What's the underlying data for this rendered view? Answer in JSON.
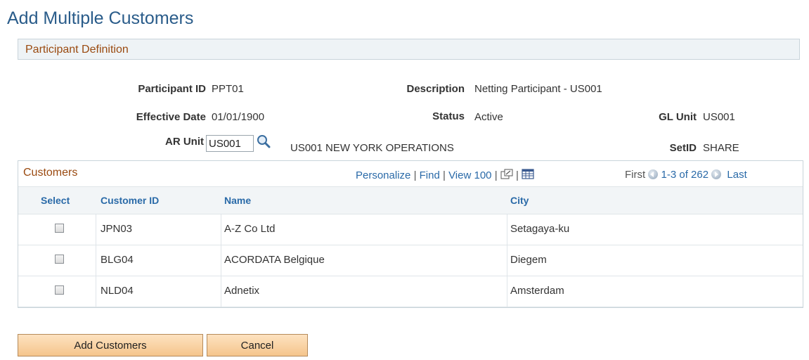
{
  "page": {
    "title": "Add Multiple Customers"
  },
  "section": {
    "title": "Participant Definition"
  },
  "fields": {
    "participant_id_label": "Participant ID",
    "participant_id_value": "PPT01",
    "description_label": "Description",
    "description_value": "Netting Participant - US001",
    "effective_date_label": "Effective Date",
    "effective_date_value": "01/01/1900",
    "status_label": "Status",
    "status_value": "Active",
    "gl_unit_label": "GL Unit",
    "gl_unit_value": "US001",
    "ar_unit_label": "AR Unit",
    "ar_unit_value": "US001",
    "ar_unit_description": "US001 NEW YORK OPERATIONS",
    "setid_label": "SetID",
    "setid_value": "SHARE"
  },
  "grid": {
    "title": "Customers",
    "personalize": "Personalize",
    "find": "Find",
    "view": "View 100",
    "first": "First",
    "range": "1-3 of 262",
    "last": "Last",
    "columns": [
      "Select",
      "Customer ID",
      "Name",
      "City"
    ],
    "rows": [
      {
        "customer_id": "JPN03",
        "name": "A-Z Co Ltd",
        "city": "Setagaya-ku"
      },
      {
        "customer_id": "BLG04",
        "name": "ACORDATA Belgique",
        "city": "Diegem"
      },
      {
        "customer_id": "NLD04",
        "name": "Adnetix",
        "city": "Amsterdam"
      }
    ]
  },
  "buttons": {
    "add": "Add Customers",
    "cancel": "Cancel"
  },
  "icons": {
    "lookup": "magnifier-icon",
    "new_window": "new-window-icon",
    "grid_view": "grid-icon",
    "prev": "prev-circle-icon",
    "next": "next-circle-icon"
  },
  "colors": {
    "title": "#2a5c8a",
    "section_label": "#9a4a10",
    "link": "#2a6aa8",
    "button": "#f5c58c"
  }
}
